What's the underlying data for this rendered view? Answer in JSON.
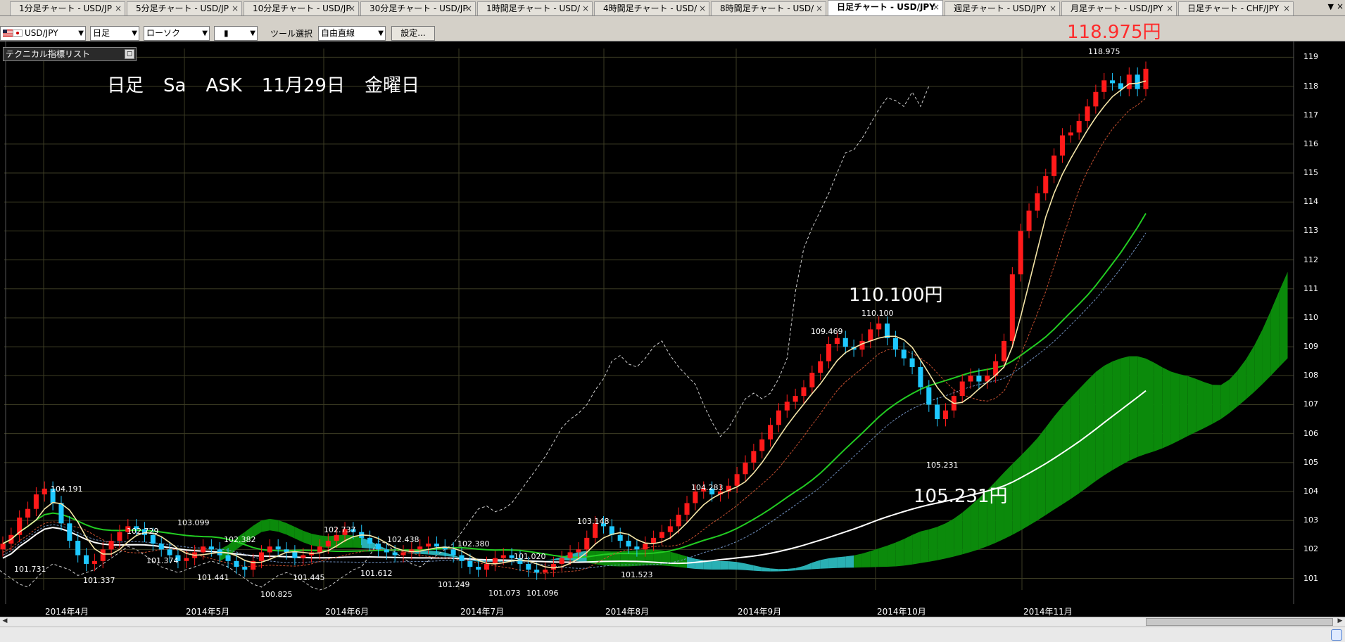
{
  "tabs": [
    {
      "label": "1分足チャート - USD/JP"
    },
    {
      "label": "5分足チャート - USD/JP"
    },
    {
      "label": "10分足チャート - USD/JP"
    },
    {
      "label": "30分足チャート - USD/JP"
    },
    {
      "label": "1時間足チャート - USD/"
    },
    {
      "label": "4時間足チャート - USD/"
    },
    {
      "label": "8時間足チャート - USD/"
    },
    {
      "label": "日足チャート - USD/JPY"
    },
    {
      "label": "週足チャート - USD/JPY"
    },
    {
      "label": "月足チャート - USD/JPY"
    },
    {
      "label": "日足チャート - CHF/JPY"
    }
  ],
  "tab_close": "×",
  "active_tab": 7,
  "toolbar": {
    "symbol": "USD/JPY",
    "timeframe": "日足",
    "chart_type": "ローソク",
    "candle_style": "▮",
    "tool_label": "ツール選択",
    "tool_value": "自由直線",
    "settings_label": "設定..."
  },
  "indicator_panel": {
    "label": "テクニカル指標リスト",
    "toggle": "◻"
  },
  "chart_header": {
    "timeframe": "日足",
    "mode": "Sa",
    "side": "ASK",
    "date": "11月29日",
    "weekday": "金曜日"
  },
  "current_price": "118.975円",
  "callouts": [
    {
      "name": "high-callout",
      "text": "110.100円"
    },
    {
      "name": "low-callout",
      "text": "105.231円"
    }
  ],
  "price_labels": [
    "104.191",
    "101.731",
    "101.337",
    "103.099",
    "102.729",
    "101.374",
    "102.382",
    "101.441",
    "100.825",
    "102.737",
    "101.445",
    "102.438",
    "101.612",
    "102.380",
    "101.249",
    "101.073",
    "101.020",
    "101.096",
    "103.148",
    "101.523",
    "104.283",
    "109.469",
    "110.100",
    "105.231",
    "118.975"
  ],
  "x_ticks": [
    "2014年4月",
    "2014年5月",
    "2014年6月",
    "2014年7月",
    "2014年8月",
    "2014年9月",
    "2014年10月",
    "2014年11月"
  ],
  "y_ticks": [
    "101",
    "102",
    "103",
    "104",
    "105",
    "106",
    "107",
    "108",
    "109",
    "110",
    "111",
    "112",
    "113",
    "114",
    "115",
    "116",
    "117",
    "118",
    "119"
  ],
  "colors": {
    "up": "#ff1a1a",
    "down": "#1ec8ff",
    "cloud_bull": "#0b8a0b",
    "cloud_bear": "#2ab0b4",
    "ma_short": "#f5e6a8",
    "ma_mid": "#22cc22",
    "ma_long": "#ffffff",
    "kijun": "#c85030",
    "tenkan_dash": "#7090c0",
    "chikou": "#cccccc",
    "grid": "#3d3d24"
  },
  "chart_data": {
    "type": "candlestick",
    "title": "",
    "ylim": [
      100.6,
      119.3
    ],
    "x_ticks": [
      "2014年4月",
      "2014年5月",
      "2014年6月",
      "2014年7月",
      "2014年8月",
      "2014年9月",
      "2014年10月",
      "2014年11月"
    ],
    "closes": [
      102.2,
      102.5,
      103.1,
      103.4,
      103.9,
      104.1,
      103.6,
      102.9,
      102.3,
      101.8,
      101.5,
      101.6,
      102.0,
      102.3,
      102.6,
      102.8,
      102.7,
      102.5,
      102.2,
      102.0,
      101.8,
      101.6,
      101.7,
      101.9,
      102.1,
      102.0,
      101.8,
      101.6,
      101.4,
      101.3,
      101.6,
      101.9,
      102.1,
      102.0,
      101.9,
      101.7,
      101.8,
      101.9,
      102.1,
      102.3,
      102.5,
      102.7,
      102.6,
      102.4,
      102.2,
      102.0,
      101.9,
      101.8,
      101.9,
      102.0,
      102.1,
      102.2,
      102.1,
      102.0,
      101.8,
      101.6,
      101.4,
      101.3,
      101.5,
      101.7,
      101.8,
      101.7,
      101.5,
      101.3,
      101.2,
      101.3,
      101.5,
      101.7,
      101.9,
      102.0,
      102.4,
      102.9,
      102.8,
      102.5,
      102.3,
      102.1,
      102.0,
      102.2,
      102.4,
      102.6,
      102.8,
      103.2,
      103.6,
      104.0,
      104.1,
      103.9,
      104.0,
      104.2,
      104.6,
      105.0,
      105.4,
      105.8,
      106.3,
      106.8,
      107.1,
      107.3,
      107.6,
      108.1,
      108.5,
      109.1,
      109.3,
      109.0,
      108.9,
      109.2,
      109.6,
      109.8,
      109.3,
      108.9,
      108.6,
      108.3,
      107.6,
      107.0,
      106.5,
      106.8,
      107.3,
      107.8,
      108.0,
      107.8,
      108.0,
      108.5,
      109.2,
      111.5,
      113.0,
      113.7,
      114.3,
      114.9,
      115.6,
      116.3,
      116.4,
      116.8,
      117.3,
      117.8,
      118.2,
      118.1,
      117.9,
      118.4,
      117.9,
      118.6
    ]
  }
}
